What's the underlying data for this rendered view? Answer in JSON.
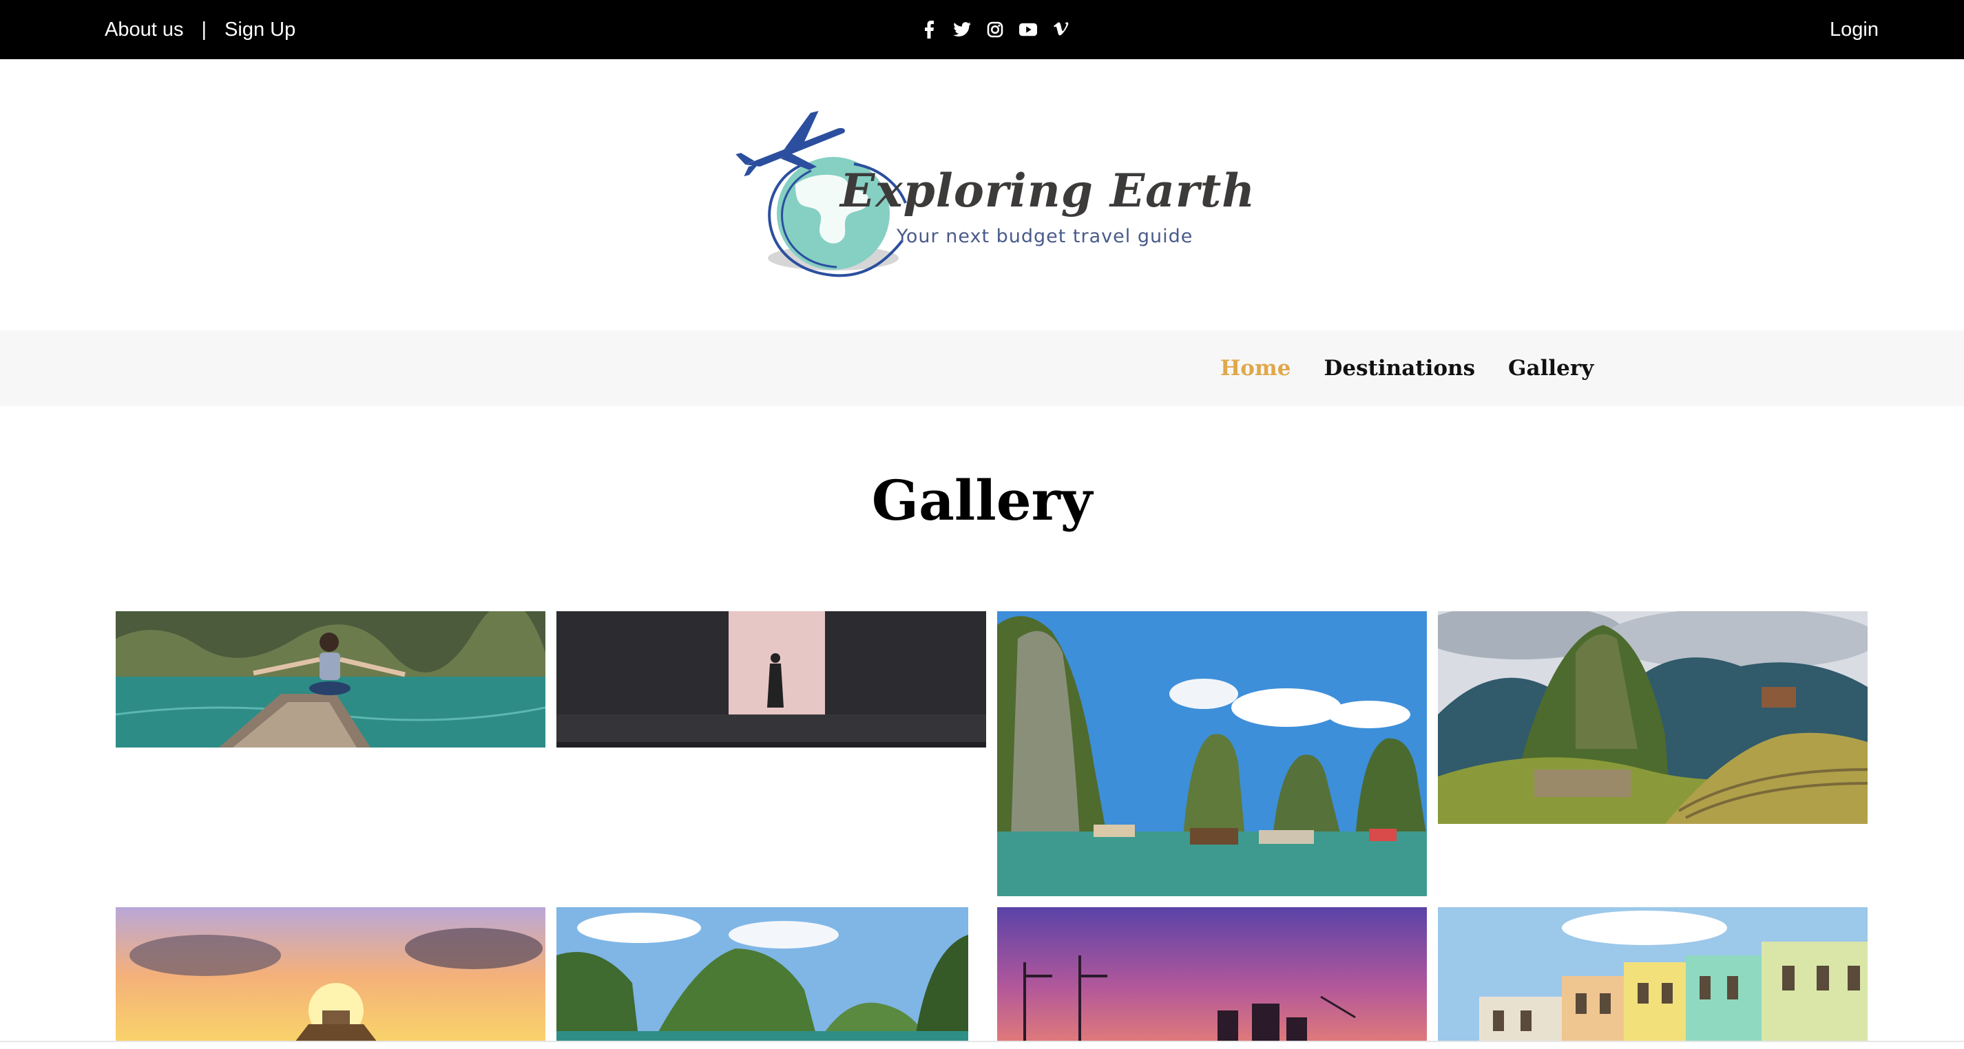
{
  "topbar": {
    "about": "About us",
    "separator": "|",
    "signup": "Sign Up",
    "login": "Login",
    "social_icons": [
      "facebook-icon",
      "twitter-icon",
      "instagram-icon",
      "youtube-icon",
      "vimeo-icon"
    ]
  },
  "logo": {
    "name": "Exploring Earth",
    "tagline": "Your next budget travel guide"
  },
  "nav": {
    "items": [
      {
        "label": "Home",
        "active": true
      },
      {
        "label": "Destinations",
        "active": false
      },
      {
        "label": "Gallery",
        "active": false
      }
    ],
    "active_color": "#e0a84a"
  },
  "main": {
    "title": "Gallery"
  },
  "gallery": {
    "images": [
      "woman-in-boat-on-lake",
      "person-standing-in-temple-gate",
      "ha-long-bay-limestone-karsts",
      "machu-picchu",
      "pyramid-at-sunset",
      "green-lagoon-cliffs",
      "harbor-at-dusk",
      "colorful-colonial-buildings"
    ]
  }
}
